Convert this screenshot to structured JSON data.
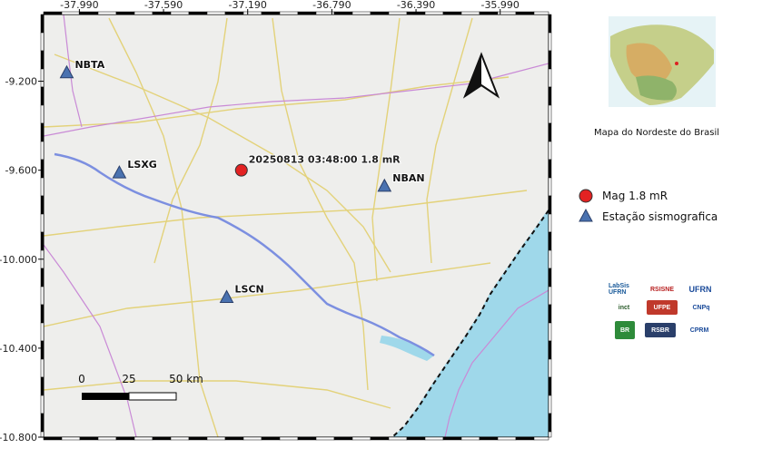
{
  "map": {
    "x_ticks": [
      "-37.990",
      "-37.590",
      "-37.190",
      "-36.790",
      "-36.390",
      "-35.990"
    ],
    "y_ticks": [
      "-9.200",
      "-9.600",
      "-10.000",
      "-10.400",
      "-10.800"
    ],
    "x_range": [
      -38.16,
      -35.76
    ],
    "y_range": [
      -8.9,
      -10.8
    ],
    "colors": {
      "land": "#eeeeec",
      "sea": "#9fd8ea",
      "river": "#7c8fe0",
      "road": "#e8d98a",
      "boundary": "#c98ad6",
      "coast_dash": "#111111"
    }
  },
  "stations": [
    {
      "name": "NBTA",
      "lon": -38.05,
      "lat": -9.16
    },
    {
      "name": "LSXG",
      "lon": -37.8,
      "lat": -9.61
    },
    {
      "name": "NBAN",
      "lon": -36.54,
      "lat": -9.67
    },
    {
      "name": "LSCN",
      "lon": -37.29,
      "lat": -10.17
    }
  ],
  "event": {
    "label": "20250813 03:48:00 1.8 mR",
    "lon": -37.22,
    "lat": -9.6,
    "color": "#e32222"
  },
  "scale_bar": {
    "labels": [
      "0",
      "25",
      "50 km"
    ]
  },
  "north_arrow": "north-arrow-icon",
  "inset": {
    "caption": "Mapa do  Nordeste do Brasil"
  },
  "legend": {
    "items": [
      {
        "label": "Mag 1.8 mR",
        "symbol": "red-circle",
        "color": "#e32222"
      },
      {
        "label": "Estação sismografica",
        "symbol": "blue-triangle",
        "color": "#4a72b0"
      }
    ]
  },
  "logos": [
    {
      "text": "LabSis UFRN"
    },
    {
      "text": "RSISNE"
    },
    {
      "text": "UFRN"
    },
    {
      "text": "inct"
    },
    {
      "text": "UFPE"
    },
    {
      "text": "CNPq"
    },
    {
      "text": "BR"
    },
    {
      "text": "RSBR"
    },
    {
      "text": "CPRM"
    }
  ]
}
